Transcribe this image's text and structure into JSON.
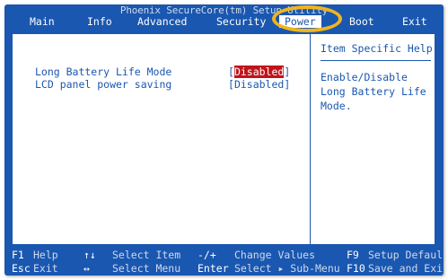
{
  "window": {
    "title": "Phoenix SecureCore(tm) Setup Utility"
  },
  "menu": {
    "items": [
      "Main",
      "Info",
      "Advanced",
      "Security",
      "Power",
      "Boot",
      "Exit"
    ],
    "active": "Power"
  },
  "settings": [
    {
      "label": "Long Battery Life Mode",
      "value": "Disabled",
      "selected": true
    },
    {
      "label": "LCD panel power saving",
      "value": "Disabled",
      "selected": false
    }
  ],
  "help": {
    "title": "Item Specific Help",
    "text": "Enable/Disable Long Battery Life Mode."
  },
  "footer": {
    "row1": [
      {
        "key": "F1",
        "desc": "Help"
      },
      {
        "key": "↑↓",
        "desc": "Select Item"
      },
      {
        "key": "-/+",
        "desc": "Change Values"
      },
      {
        "key": "F9",
        "desc": "Setup Defaults"
      }
    ],
    "row2": [
      {
        "key": "Esc",
        "desc": "Exit"
      },
      {
        "key": "↔",
        "desc": "Select Menu"
      },
      {
        "key": "Enter",
        "desc": "Select ▸ Sub-Menu"
      },
      {
        "key": "F10",
        "desc": "Save and Exit"
      }
    ]
  },
  "colors": {
    "bios_blue": "#1a57b0",
    "highlight_red": "#c0141b",
    "annotation_ring": "#f1b51b"
  }
}
